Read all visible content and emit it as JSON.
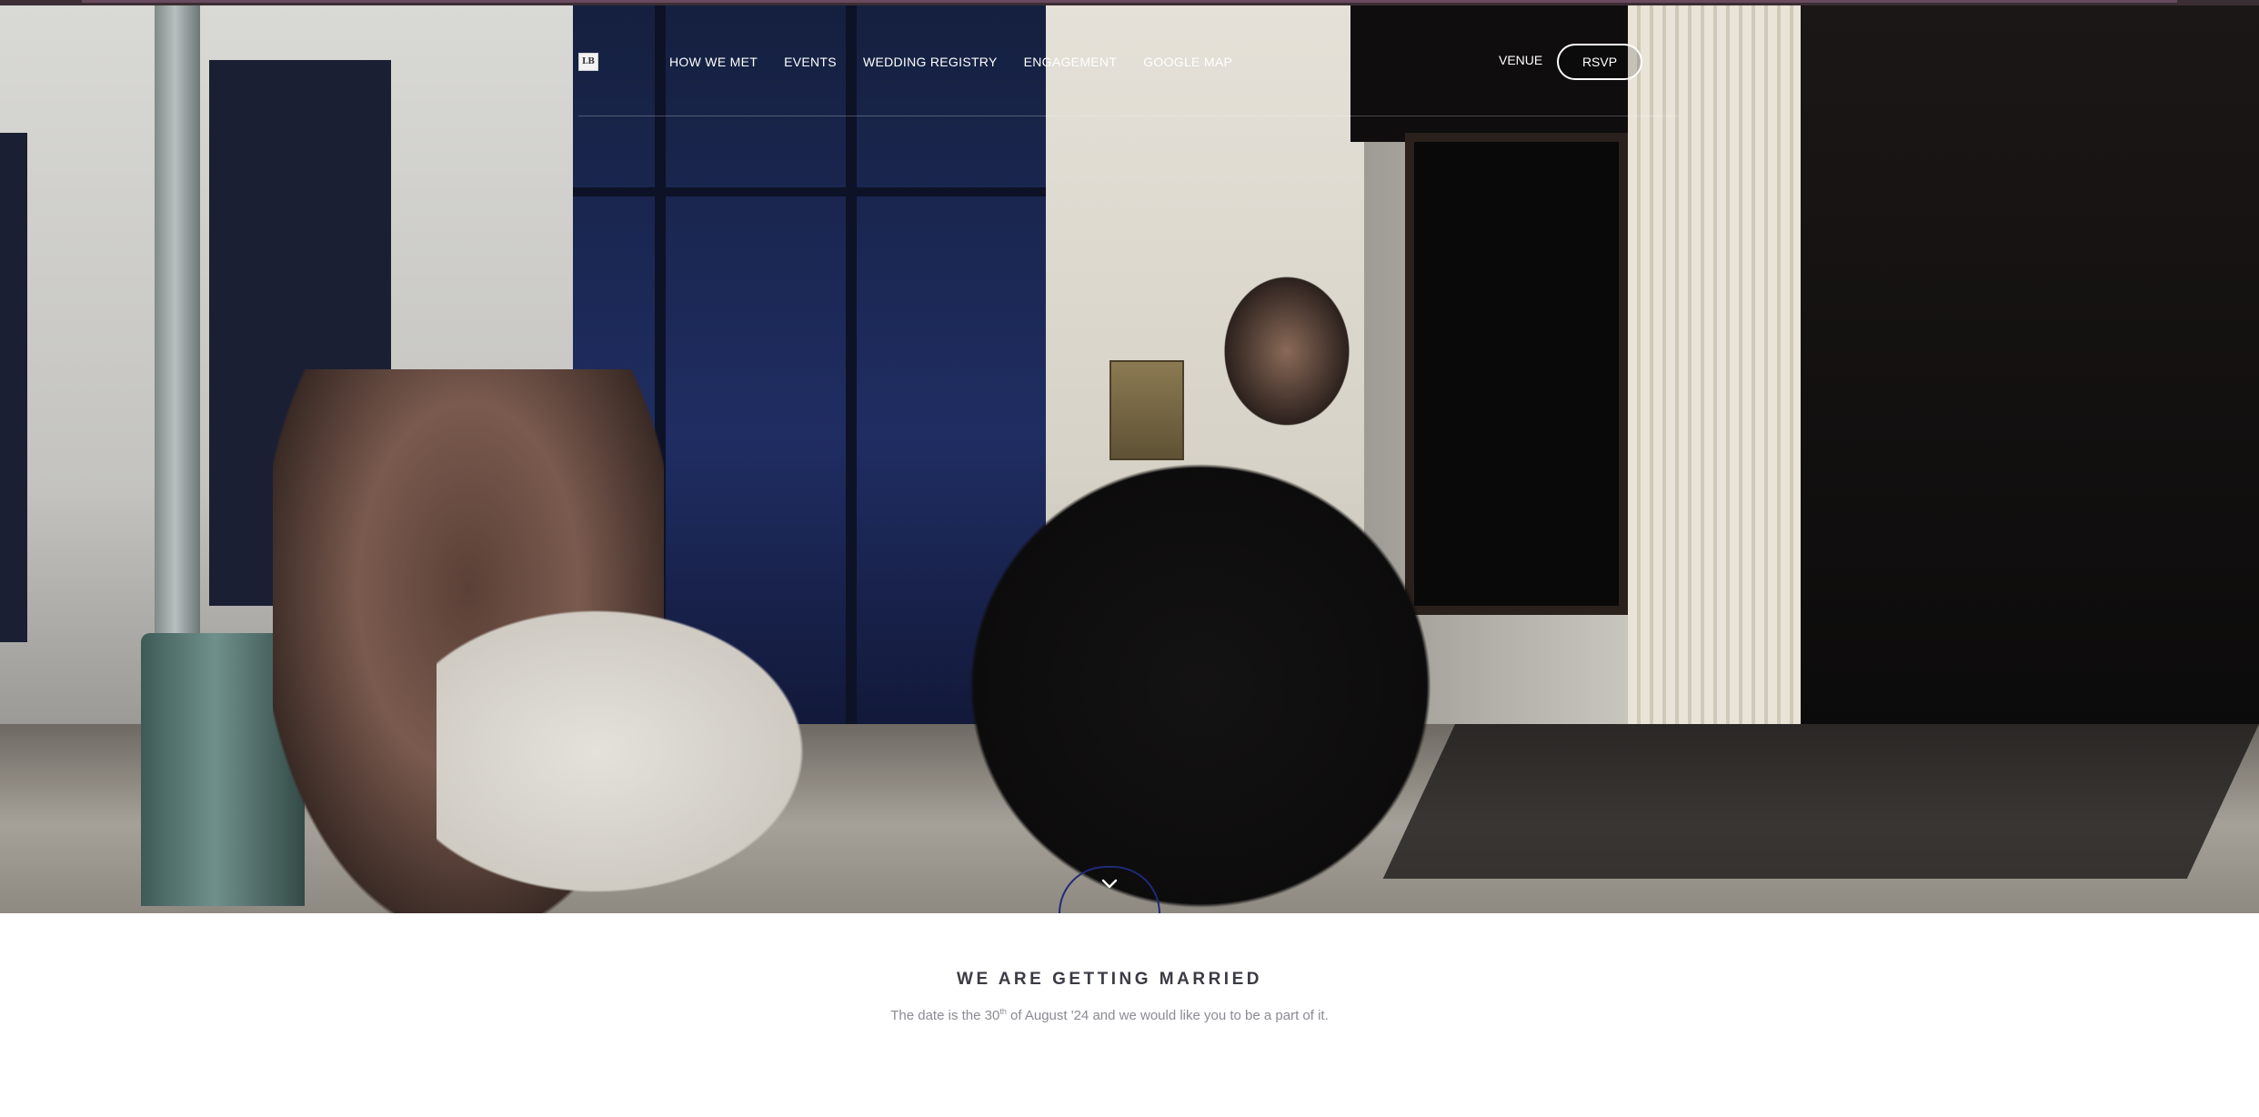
{
  "logo": {
    "text": "LB"
  },
  "nav": {
    "items": [
      "HOW WE MET",
      "EVENTS",
      "WEDDING REGISTRY",
      "ENGAGEMENT",
      "GOOGLE MAP"
    ],
    "venue": "VENUE",
    "rsvp": "RSVP"
  },
  "hero": {
    "image": "couple-walking-hand-in-hand-photo",
    "scroll_icon": "chevron-down-icon"
  },
  "intro": {
    "title": "WE ARE GETTING MARRIED",
    "date_prefix": "The date is the 30",
    "date_sup": "th",
    "date_suffix": " of August '24 and we would like you to be a part of it."
  },
  "colors": {
    "accent": "#1f2a78",
    "title": "#3b3b45",
    "subtitle": "#8b8b93",
    "nav_text": "#ffffff"
  }
}
